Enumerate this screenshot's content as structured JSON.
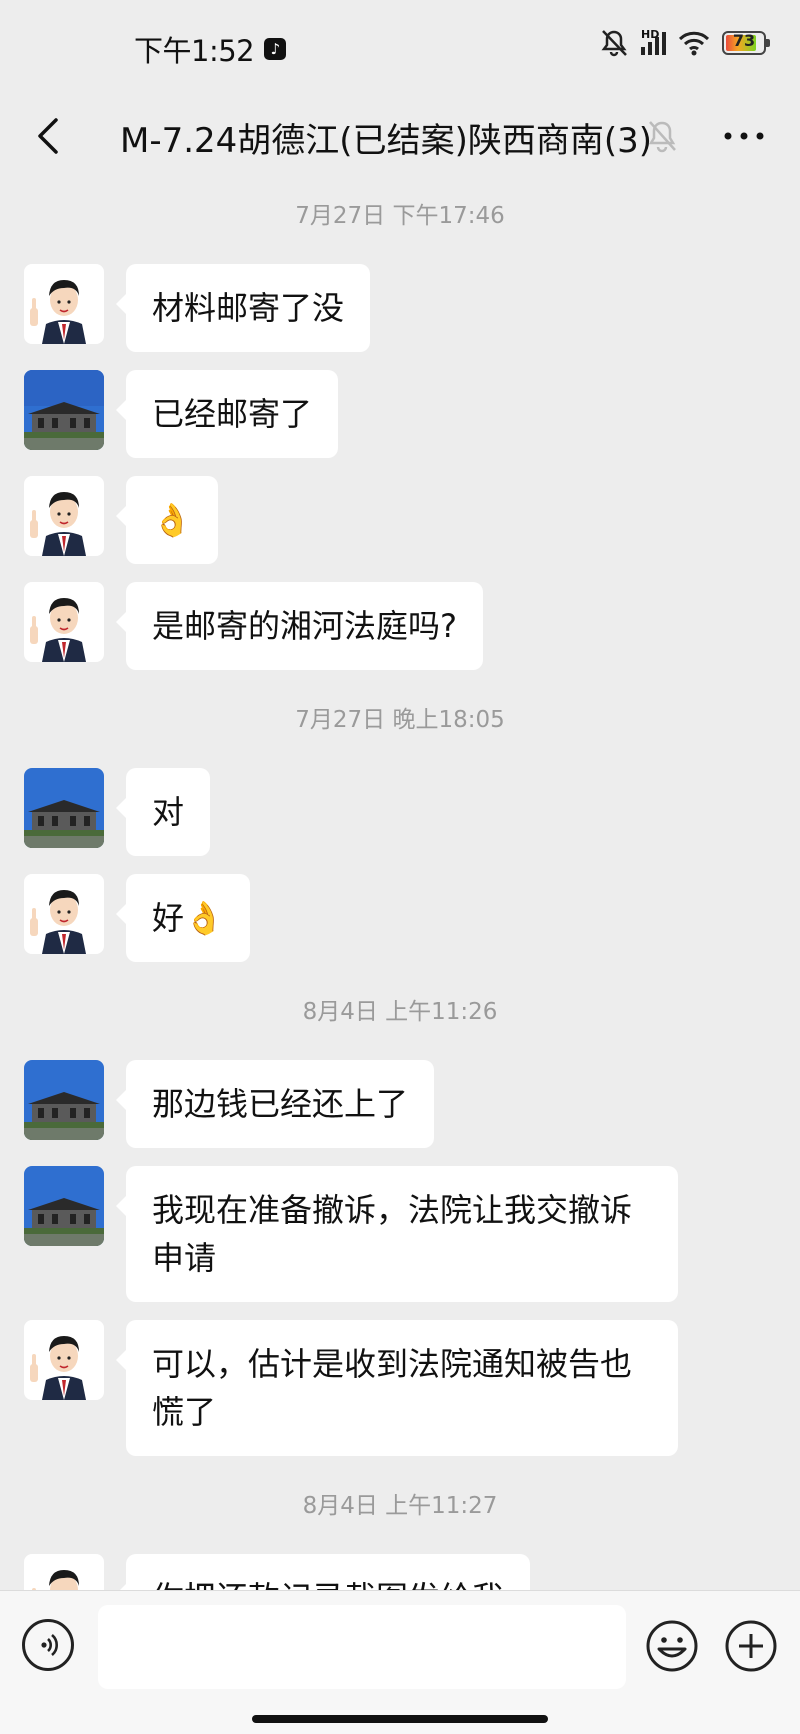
{
  "status_bar": {
    "time": "下午1:52",
    "network": "HD",
    "battery": "73"
  },
  "header": {
    "title": "M-7.24胡德江(已结案)陕西商南(3)"
  },
  "messages": [
    {
      "type": "timestamp",
      "text": "7月27日 下午17:46"
    },
    {
      "type": "bubble",
      "sender": "lawyer",
      "text": "材料邮寄了没"
    },
    {
      "type": "bubble",
      "sender": "client",
      "text": "已经邮寄了"
    },
    {
      "type": "bubble",
      "sender": "lawyer",
      "text": "👌"
    },
    {
      "type": "bubble",
      "sender": "lawyer",
      "text": "是邮寄的湘河法庭吗?"
    },
    {
      "type": "timestamp",
      "text": "7月27日 晚上18:05"
    },
    {
      "type": "bubble",
      "sender": "client",
      "text": "对"
    },
    {
      "type": "bubble",
      "sender": "lawyer",
      "text": "好👌"
    },
    {
      "type": "timestamp",
      "text": "8月4日 上午11:26"
    },
    {
      "type": "bubble",
      "sender": "client",
      "text": "那边钱已经还上了"
    },
    {
      "type": "bubble",
      "sender": "client",
      "text": "我现在准备撤诉，法院让我交撤诉申请"
    },
    {
      "type": "bubble",
      "sender": "lawyer",
      "text": "可以，估计是收到法院通知被告也慌了"
    },
    {
      "type": "timestamp",
      "text": "8月4日 上午11:27"
    },
    {
      "type": "bubble",
      "sender": "lawyer",
      "text": "你把还款记录截图发给我"
    }
  ],
  "input": {
    "placeholder": ""
  },
  "colors": {
    "background": "#ededed",
    "bubble": "#ffffff",
    "timestamp": "#9a9a9a"
  },
  "icons": {
    "back": "chevron-left-icon",
    "mute": "bell-off-icon",
    "more": "more-dots-icon",
    "voice": "voice-icon",
    "emoji": "emoji-icon",
    "plus": "plus-circle-icon"
  }
}
